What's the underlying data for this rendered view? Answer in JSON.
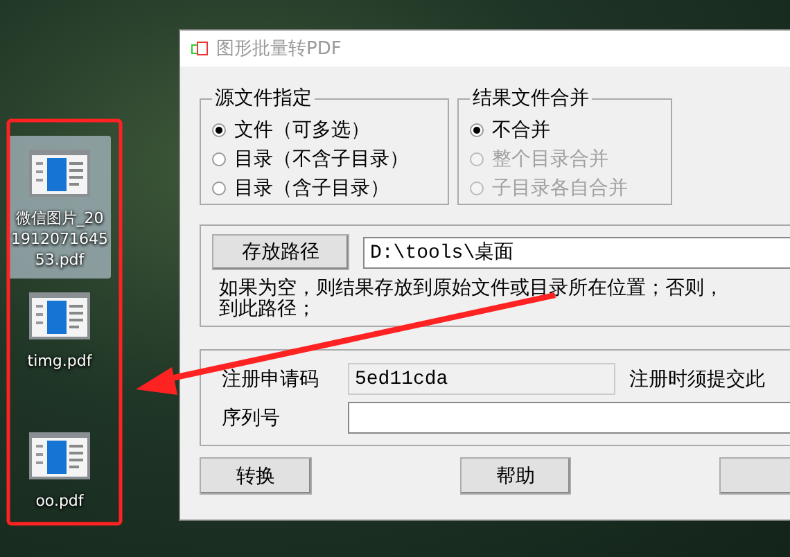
{
  "desktop_icons": [
    {
      "label": "微信图片_20191207164553.pdf",
      "selected": true
    },
    {
      "label": "timg.pdf",
      "selected": false
    },
    {
      "label": "oo.pdf",
      "selected": false
    }
  ],
  "window": {
    "title": "图形批量转PDF"
  },
  "source_group": {
    "title": "源文件指定",
    "options": [
      {
        "label": "文件（可多选）",
        "selected": true,
        "disabled": false
      },
      {
        "label": "目录（不含子目录）",
        "selected": false,
        "disabled": false
      },
      {
        "label": "目录（含子目录）",
        "selected": false,
        "disabled": false
      }
    ]
  },
  "merge_group": {
    "title": "结果文件合并",
    "options": [
      {
        "label": "不合并",
        "selected": true,
        "disabled": false
      },
      {
        "label": "整个目录合并",
        "selected": false,
        "disabled": true
      },
      {
        "label": "子目录各自合并",
        "selected": false,
        "disabled": true
      }
    ]
  },
  "output_path": {
    "button": "存放路径",
    "value": "D:\\tools\\桌面",
    "hint_lines": [
      "如果为空，则结果存放到原始文件或目录所在位置；否则，",
      "到此路径；"
    ]
  },
  "registration": {
    "request_code_label": "注册申请码",
    "request_code": "5ed11cda",
    "request_note": "注册时须提交此",
    "serial_label": "序列号"
  },
  "buttons": [
    "转换",
    "帮助"
  ],
  "cut_off_button": true
}
